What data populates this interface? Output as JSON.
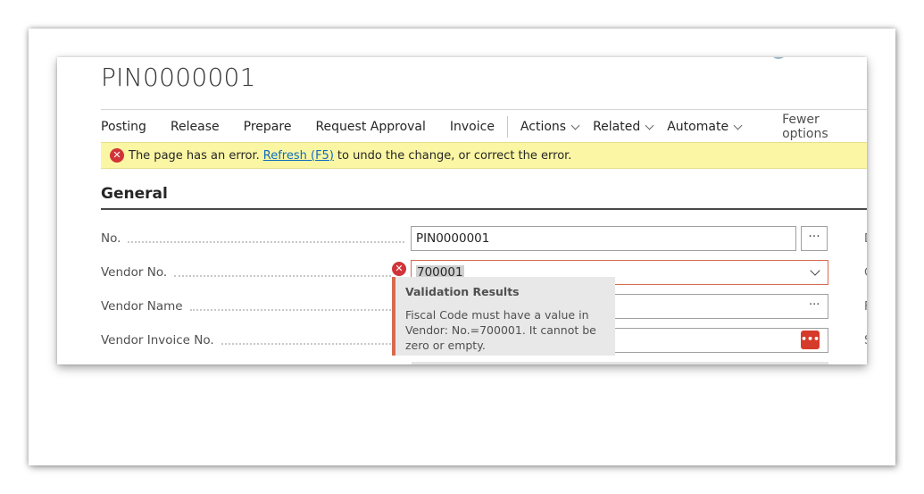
{
  "page": {
    "title": "PIN0000001"
  },
  "action_bar": {
    "items": [
      "Posting",
      "Release",
      "Prepare",
      "Request Approval",
      "Invoice"
    ],
    "menus": [
      "Actions",
      "Related",
      "Automate"
    ],
    "fewer_options": "Fewer options"
  },
  "error_banner": {
    "icon": "error-icon",
    "text_before": "The page has an error.",
    "link": "Refresh (F5)",
    "text_after": "to undo the change, or correct the error."
  },
  "section": {
    "title": "General"
  },
  "fields": {
    "no": {
      "label": "No.",
      "value": "PIN0000001",
      "lookup": "···"
    },
    "vendor_no": {
      "label": "Vendor No.",
      "value": "700001"
    },
    "vendor_name": {
      "label": "Vendor Name",
      "lookup": "···"
    },
    "vendor_invoice_no": {
      "label": "Vendor Invoice No.",
      "lookup": "•••"
    }
  },
  "validation": {
    "title": "Validation Results",
    "message": "Fiscal Code must have a value in Vendor: No.=700001. It cannot be zero or empty."
  },
  "right_column_letters": [
    "D",
    "C",
    "F",
    "S"
  ],
  "colors": {
    "error_red": "#d13438",
    "banner_yellow": "#fbf6a4",
    "link_blue": "#0f6cbd"
  }
}
